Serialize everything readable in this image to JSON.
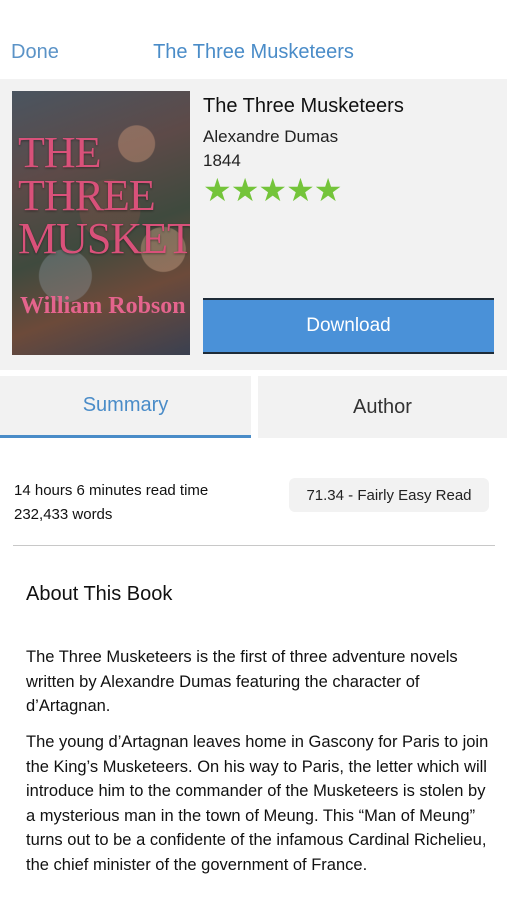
{
  "nav": {
    "done_label": "Done",
    "title": "The Three Musketeers"
  },
  "cover": {
    "title": "THE THREE MUSKETEERS",
    "author": "William Robson"
  },
  "book": {
    "title": "The Three Musketeers",
    "author": "Alexandre Dumas",
    "year": "1844",
    "rating": 5,
    "rating_max": 5,
    "star_color": "#74c43a"
  },
  "download_label": "Download",
  "tabs": [
    {
      "label": "Summary",
      "active": true
    },
    {
      "label": "Author",
      "active": false
    }
  ],
  "stats": {
    "read_time": "14 hours 6 minutes read time",
    "words": "232,433 words",
    "readability": "71.34 - Fairly Easy Read"
  },
  "about": {
    "heading": "About This Book",
    "paragraphs": [
      "The Three Musketeers is the first of three adventure novels written by Alexandre Dumas featuring the character of d’Artagnan.",
      "The young d’Artagnan leaves home in Gascony for Paris to join the King’s Musketeers. On his way to Paris, the letter which will introduce him to the commander of the Musketeers is stolen by a mysterious man in the town of Meung. This “Man of Meung” turns out to be a confidente of the infamous Cardinal Richelieu, the chief minister of the government of France."
    ]
  },
  "colors": {
    "accent": "#4a8cc8",
    "button": "#4a91d8",
    "panel": "#f2f2f2"
  }
}
